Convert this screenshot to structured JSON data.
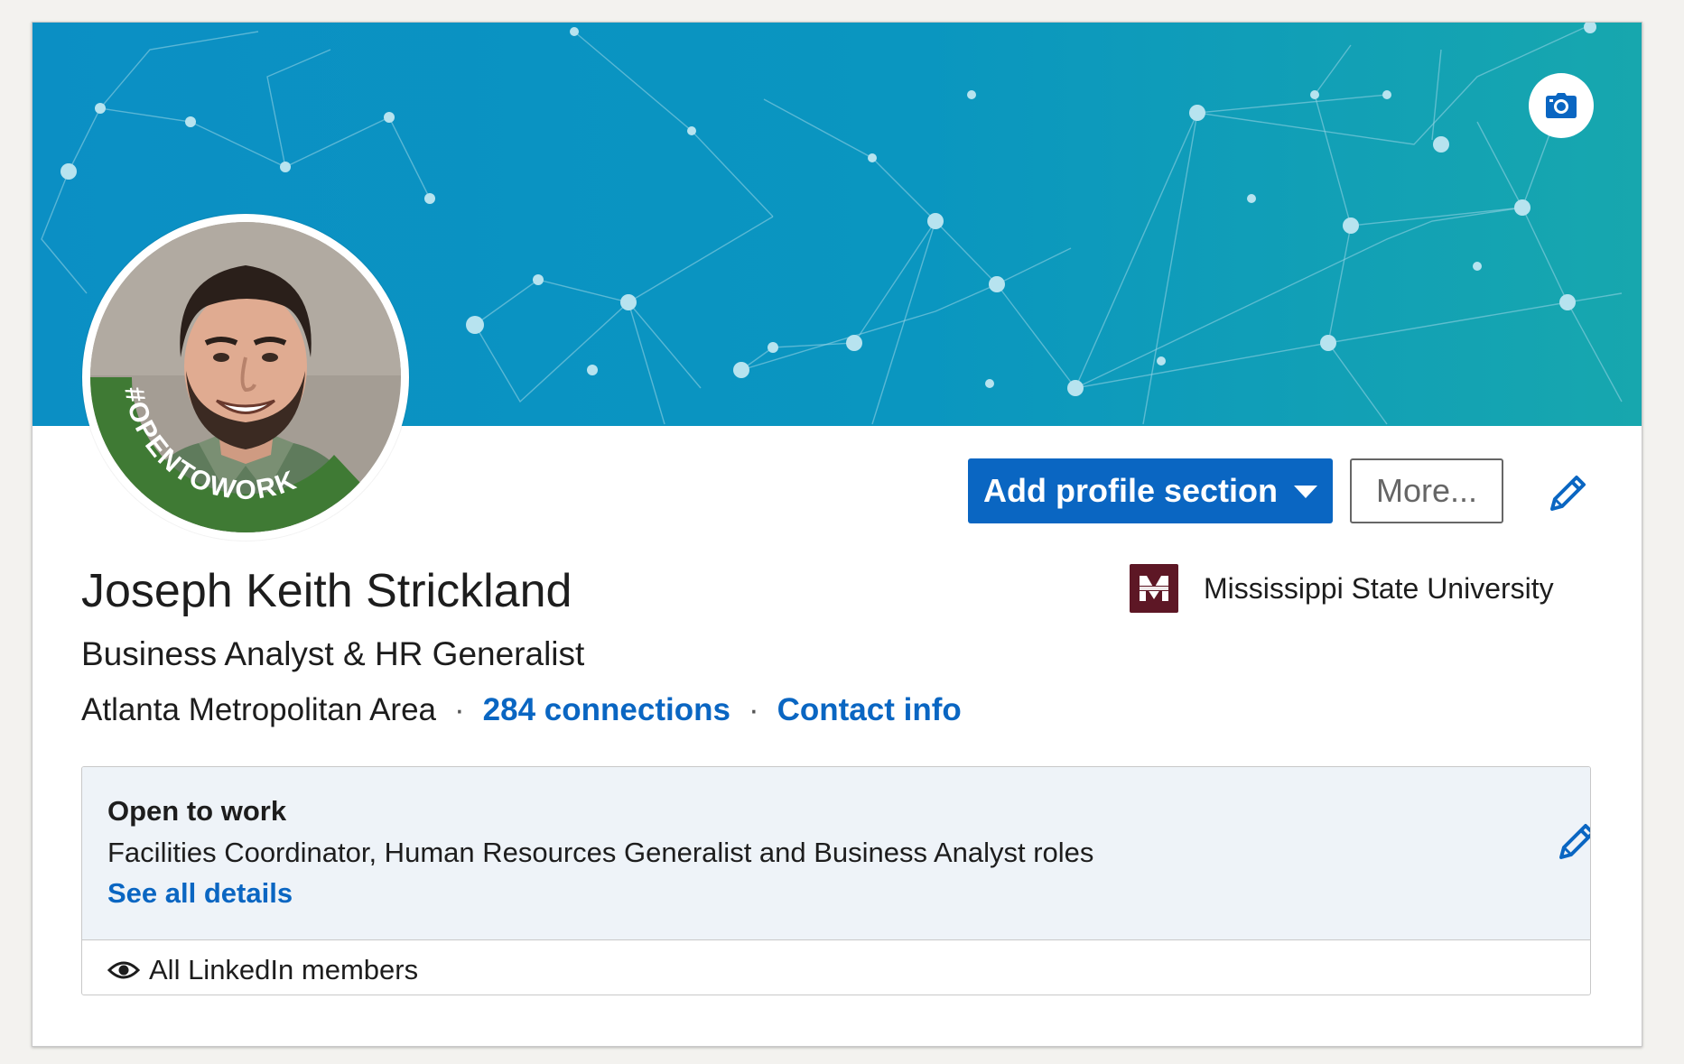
{
  "profile": {
    "name": "Joseph Keith Strickland",
    "headline": "Business Analyst & HR Generalist",
    "location": "Atlanta Metropolitan Area",
    "connections": "284 connections",
    "contact_info": "Contact info",
    "separator": "·",
    "avatar_badge": "#OPENTOWORK"
  },
  "education": {
    "school": "Mississippi State University",
    "logo_icon": "msstate-logo-icon"
  },
  "actions": {
    "add_section_label": "Add profile section",
    "more_label": "More..."
  },
  "open_to_work": {
    "title": "Open to work",
    "roles": "Facilities Coordinator, Human Resources Generalist and Business Analyst roles",
    "details_link": "See all details",
    "visibility": "All LinkedIn members"
  },
  "colors": {
    "accent": "#0a66c2",
    "banner_start": "#0b8fc4",
    "banner_end": "#13a6b0",
    "opentowork_green": "#3f7a34",
    "school_maroon": "#5d1725"
  }
}
